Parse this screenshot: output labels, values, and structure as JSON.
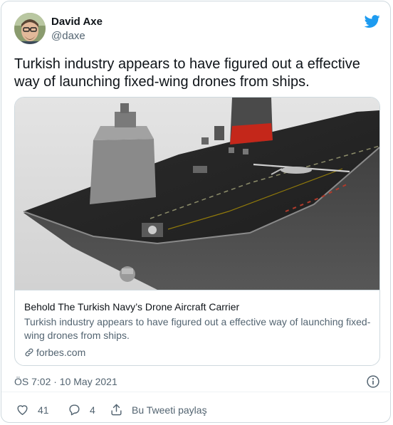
{
  "author": {
    "display_name": "David Axe",
    "handle": "@daxe"
  },
  "tweet": {
    "text": "Turkish industry appears to have figured out a effective way of launching fixed-wing drones from ships."
  },
  "card": {
    "title": "Behold The Turkish Navy’s Drone Aircraft Carrier",
    "description": "Turkish industry appears to have figured out a effective way of launching fixed-wing drones from ships.",
    "domain": "forbes.com"
  },
  "meta": {
    "timestamp": "ÖS 7:02 · 10 May 2021"
  },
  "actions": {
    "like_count": "41",
    "reply_count": "4",
    "share_label": "Bu Tweeti paylaş"
  },
  "colors": {
    "twitter_blue": "#1d9bf0",
    "secondary_text": "#536471",
    "border": "#cfd9de"
  },
  "icons": {
    "brand": "twitter-bird-icon",
    "link": "link-icon",
    "info": "info-icon",
    "like": "heart-icon",
    "reply": "reply-bubble-icon",
    "share": "share-icon"
  }
}
